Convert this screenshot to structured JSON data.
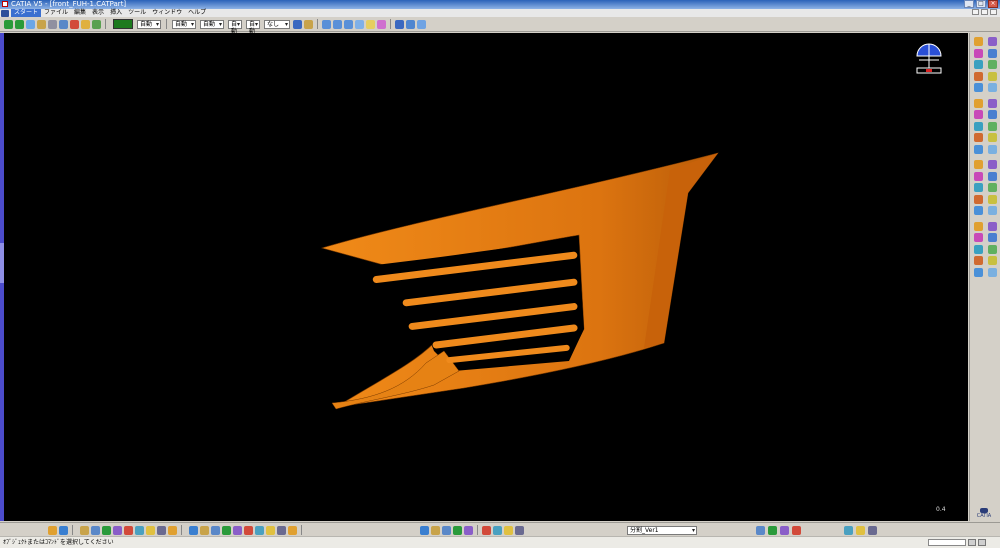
{
  "window": {
    "title": "CATIA V5 - [front_FUH-1.CATPart]",
    "buttons": {
      "minimize": "_",
      "maximize": "□",
      "close": "×"
    }
  },
  "menu": {
    "items": [
      "スタート",
      "ファイル",
      "編集",
      "表示",
      "挿入",
      "ツール",
      "ウィンドウ",
      "ヘルプ"
    ]
  },
  "toolbar": {
    "color_value": "#1d7a1d",
    "transparency": "自動",
    "line_thickness": "自動",
    "line_type": "自動",
    "point_symbol": "自動",
    "layer_label": "自動",
    "rendering": "なし"
  },
  "bottom": {
    "body_selector": "分割_Ver1"
  },
  "status": {
    "message": "ｵﾌﾞｼﾞｪｸﾄまたはｺﾏﾝﾄﾞを選択してください"
  },
  "viewport": {
    "background": "#000000",
    "part_color": "#e07a0c",
    "scale_label": "0.4",
    "logo_text": "CATIA"
  },
  "icons": {
    "toolbar": [
      "pan-icon",
      "rotate-icon",
      "zoom-icon",
      "sketch-icon",
      "select-icon",
      "search-icon",
      "text-icon",
      "measure-icon",
      "paint-icon"
    ],
    "right_toolbar": [
      "pad-icon",
      "pocket-icon",
      "shaft-icon",
      "groove-icon",
      "hole-icon",
      "rib-icon",
      "slot-icon",
      "loft-icon",
      "fillet-icon",
      "chamfer-icon",
      "draft-icon",
      "shell-icon",
      "thickness-icon",
      "thread-icon",
      "split-icon",
      "thick-surface-icon",
      "close-surface-icon",
      "sew-surface-icon",
      "translate-icon",
      "rotate-feature-icon",
      "symmetry-icon",
      "mirror-icon",
      "pattern-icon",
      "scale-icon",
      "boolean-icon",
      "assemble-icon",
      "add-icon",
      "remove-icon",
      "intersect-icon",
      "union-trim-icon",
      "remove-lump-icon",
      "point-icon",
      "line-icon",
      "plane-icon",
      "axis-icon",
      "measure-between-icon",
      "analysis-icon",
      "constraint-icon",
      "formula-icon",
      "catalog-icon"
    ],
    "bottom_toolbar": [
      "update-icon",
      "axis-system-icon",
      "new-icon",
      "open-icon",
      "save-icon",
      "print-icon",
      "cut-icon",
      "copy-icon",
      "paste-icon",
      "undo-icon",
      "redo-icon",
      "whatsthis-icon",
      "fly-icon",
      "fit-all-icon",
      "pan2-icon",
      "rotate2-icon",
      "zoom-in-icon",
      "zoom-out-icon",
      "normal-view-icon",
      "iso-view-icon",
      "shading-icon",
      "hide-show-icon",
      "swap-space-icon",
      "material-icon",
      "apply-material-icon",
      "body-icon",
      "sketcher-icon",
      "reorder-icon",
      "parameters-icon",
      "geometry-icon"
    ]
  }
}
